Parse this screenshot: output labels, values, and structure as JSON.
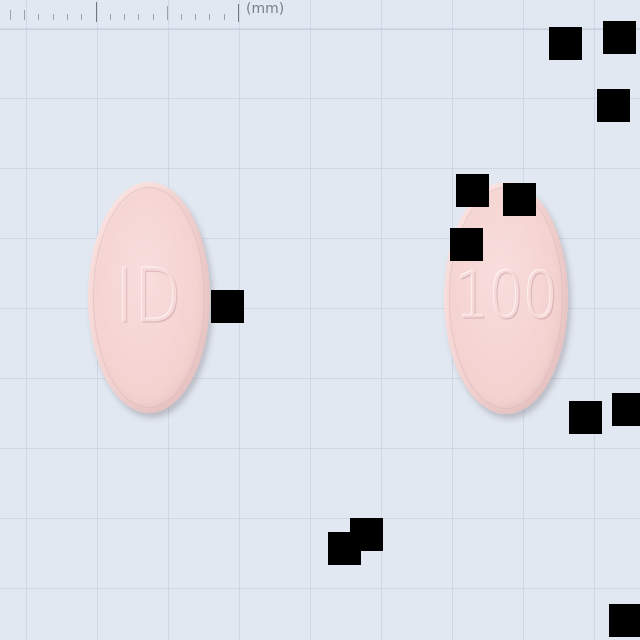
{
  "ruler": {
    "unit_label": "(mm)"
  },
  "pills": [
    {
      "imprint": "ID",
      "color": "#f4d3d1"
    },
    {
      "imprint": "100",
      "color": "#f4d3d1"
    }
  ],
  "colors": {
    "background": "#e1e8f1",
    "grid": "#becedc",
    "mask": "#000000"
  }
}
